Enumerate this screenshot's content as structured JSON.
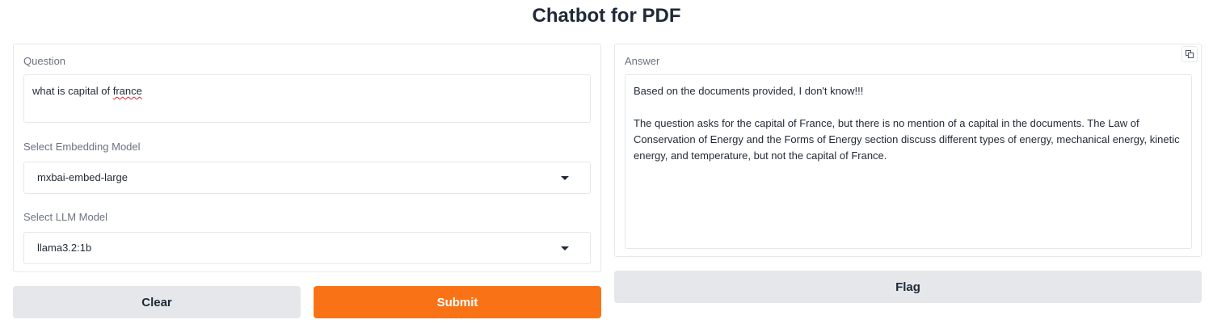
{
  "app": {
    "title": "Chatbot for PDF"
  },
  "question": {
    "label": "Question",
    "value_before": "what is capital of ",
    "value_misspelled": "france"
  },
  "embedding": {
    "label": "Select Embedding Model",
    "selected": "mxbai-embed-large"
  },
  "llm": {
    "label": "Select LLM Model",
    "selected": "llama3.2:1b"
  },
  "answer": {
    "label": "Answer",
    "value": "Based on the documents provided, I don't know!!!\n\nThe question asks for the capital of France, but there is no mention of a capital in the documents. The Law of Conservation of Energy and the Forms of Energy section discuss different types of energy, mechanical energy, kinetic energy, and temperature, but not the capital of France.",
    "copy_icon": "copy-icon"
  },
  "buttons": {
    "clear": "Clear",
    "submit": "Submit",
    "flag": "Flag"
  },
  "colors": {
    "primary": "#f97316",
    "secondary": "#e5e7eb"
  }
}
